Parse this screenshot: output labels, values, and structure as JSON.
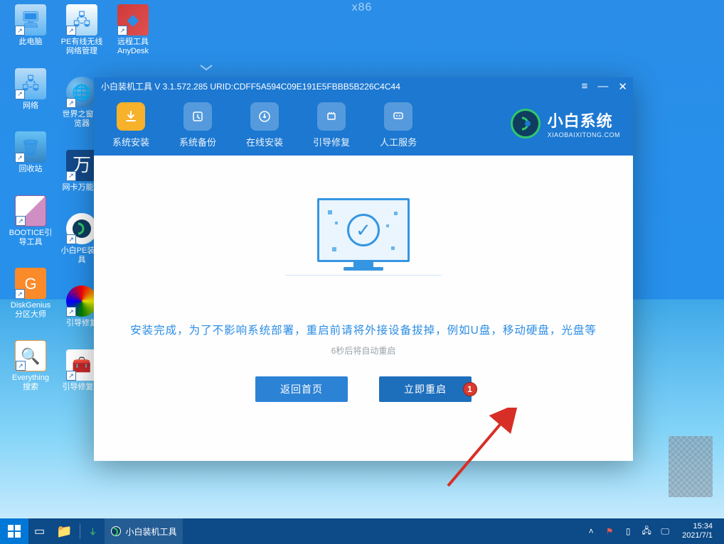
{
  "arch_label": "x86",
  "desktop": {
    "col1": [
      {
        "label": "此电脑"
      },
      {
        "label": "网络"
      },
      {
        "label": "回收站"
      },
      {
        "label": "BOOTICE引导工具"
      },
      {
        "label": "DiskGenius分区大师"
      },
      {
        "label": "Everything搜索"
      }
    ],
    "col2": [
      {
        "label": "PE有线无线网络管理"
      },
      {
        "label": "世界之窗浏览器"
      },
      {
        "label": "网卡万能驱"
      },
      {
        "label": "小白PE装机具"
      },
      {
        "label": "引导修复"
      },
      {
        "label": "引导修复工"
      }
    ],
    "col3": [
      {
        "label": "远程工具AnyDesk"
      }
    ]
  },
  "window": {
    "title": "小白装机工具 V 3.1.572.285 URID:CDFF5A594C09E191E5FBBB5B226C4C44",
    "tabs": {
      "install": "系统安装",
      "backup": "系统备份",
      "online": "在线安装",
      "bootfix": "引导修复",
      "support": "人工服务"
    },
    "brand": {
      "cn": "小白系统",
      "en": "XIAOBAIXITONG.COM"
    },
    "message": "安装完成，为了不影响系统部署，重启前请将外接设备拔掉，例如U盘，移动硬盘，光盘等",
    "sub_message": "6秒后将自动重启",
    "buttons": {
      "back": "返回首页",
      "restart": "立即重启",
      "badge": "1"
    }
  },
  "taskbar": {
    "app_label": "小白装机工具",
    "time": "15:34",
    "date": "2021/7/1"
  }
}
